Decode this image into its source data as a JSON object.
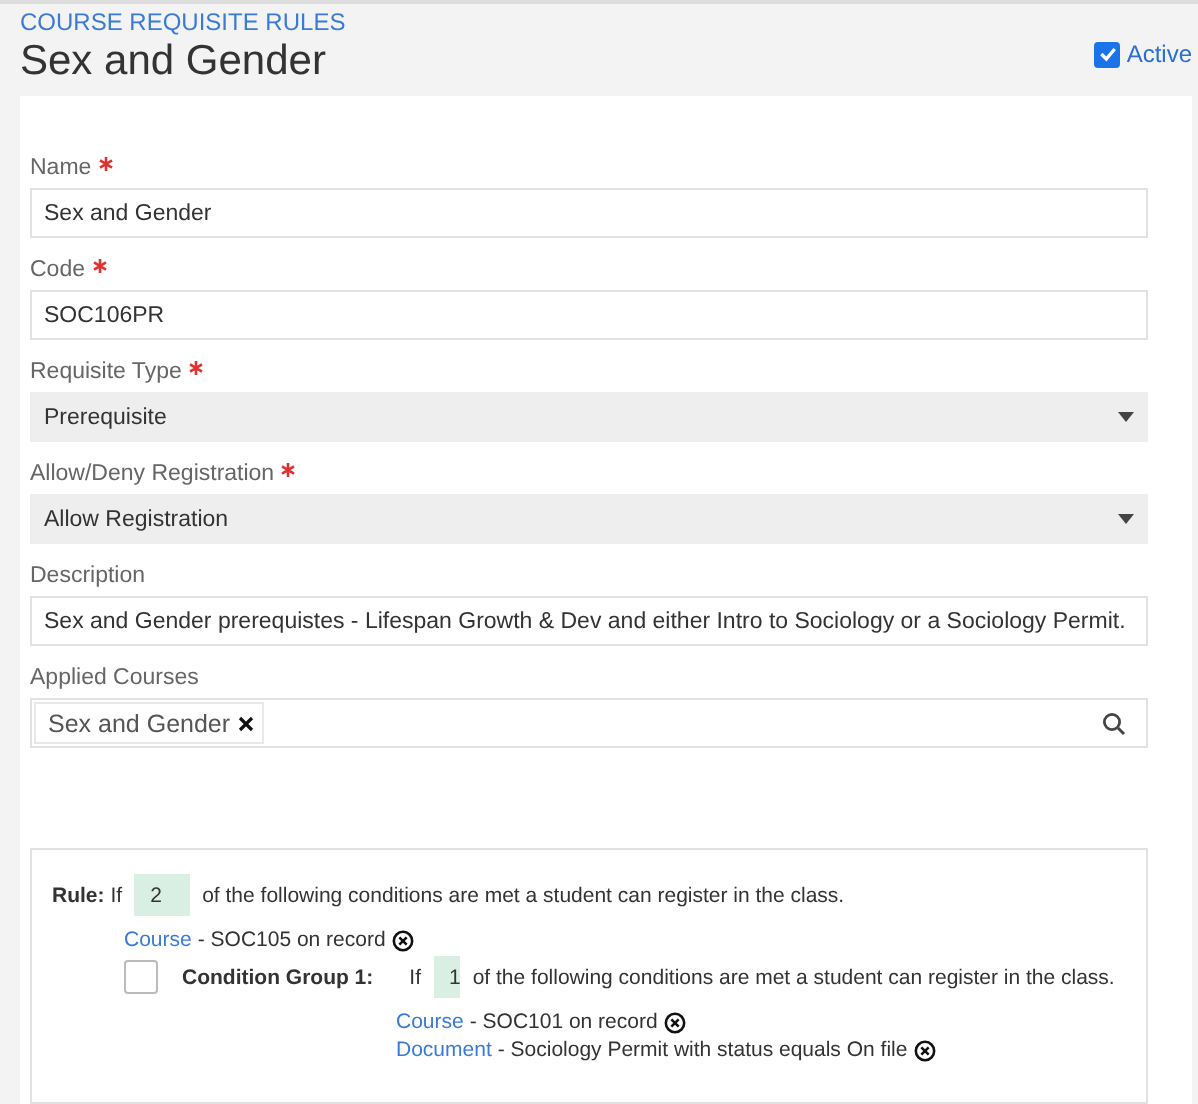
{
  "breadcrumb": "COURSE REQUISITE RULES",
  "title": "Sex and Gender",
  "active": {
    "label": "Active",
    "checked": true
  },
  "fields": [
    {
      "kind": "text",
      "label": "Name",
      "required": true,
      "value": "Sex and Gender"
    },
    {
      "kind": "text",
      "label": "Code",
      "required": true,
      "value": "SOC106PR"
    },
    {
      "kind": "select",
      "label": "Requisite Type",
      "required": true,
      "value": "Prerequisite"
    },
    {
      "kind": "select",
      "label": "Allow/Deny Registration",
      "required": true,
      "value": "Allow Registration"
    },
    {
      "kind": "text",
      "label": "Description",
      "required": false,
      "value": "Sex and Gender prerequistes - Lifespan Growth & Dev and either Intro to Sociology or a Sociology Permit."
    },
    {
      "kind": "tags",
      "label": "Applied Courses",
      "required": false,
      "tags": [
        "Sex and Gender"
      ]
    }
  ],
  "rule": {
    "label": "Rule:",
    "if": "If",
    "count": "2",
    "suffix": "of the following conditions are met a student can register in the class.",
    "conditions": [
      {
        "kind": "condition",
        "type": "Course",
        "text": "- SOC105 on record"
      },
      {
        "kind": "group",
        "label": "Condition Group 1:",
        "checked": false,
        "if": "If",
        "count": "1",
        "suffix": "of the following conditions are met a student can register in the class.",
        "conditions": [
          {
            "kind": "condition",
            "type": "Course",
            "text": "- SOC101 on record"
          },
          {
            "kind": "condition",
            "type": "Document",
            "text": "- Sociology Permit with status equals On file"
          }
        ]
      }
    ]
  }
}
